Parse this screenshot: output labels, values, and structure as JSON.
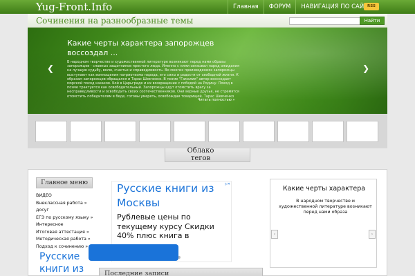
{
  "site": {
    "logo": "Yug-Front.Info",
    "subtitle": "Сочинения на разнообразные темы"
  },
  "topnav": [
    "Главная",
    "ФОРУМ",
    "НАВИГАЦИЯ ПО САЙТУ"
  ],
  "rss_label": "RSS",
  "search": {
    "placeholder": "",
    "button": "Найти"
  },
  "slider": {
    "title": "Какие черты характера запорожцев воссоздал ...",
    "text": "В народном творчестве и художественной литературе возникают перед нами образы запорожцев - славных защитников простого люда. Именно с ними связывал народ ожидания на лучшую судьбу, волю, счастье и справедливость. Во многих произведениях запорожцы выступают как воплощения патриотизма народа, его силы и радости от свободной жизни. К образам запорожцев обращался и Тарас Шевченко. В поэме \"Гамалия\" автор воссоздает морской поход казаков. Бой в Царьграде и их возвращение с победой на Родину. Поход в поэме трактуется как освободительный. Запорожцы едут отомстить врагу за несправедливости и освободить своих соотечественников. Они верные друзья, не стремятся отомстить победителям в беде, готовы умереть, освобождая товарищей. Тарас Шевченко",
    "more": "Читать полностью »",
    "prev": "❮",
    "next": "❯"
  },
  "tag_tab": "Облако тегов",
  "main_menu": {
    "title": "Главное меню",
    "items": [
      "ВИДЕО",
      "Внеклассная работа »",
      "досуг",
      "ЕГЭ по русскому языку »",
      "Интересное",
      "Итоговая аттестация »",
      "Методическая работа »",
      "Подход к сочинению »"
    ]
  },
  "ad": {
    "title": "Русские книги из Москвы",
    "text": "Рублевые цены по текущему курсу Скидки 40% плюс книга в",
    "badge": "▷✕"
  },
  "ad2": {
    "title": "Русские книги из"
  },
  "recent_title": "Последние записи",
  "side_post": {
    "title": "Какие черты характера",
    "text": "В народном творчестве и художественной литературе возникают перед нами образа"
  },
  "colors": {
    "brand_green": "#4f9a25",
    "ad_blue": "#1a73d9",
    "page_bg": "#e9e9e9"
  }
}
